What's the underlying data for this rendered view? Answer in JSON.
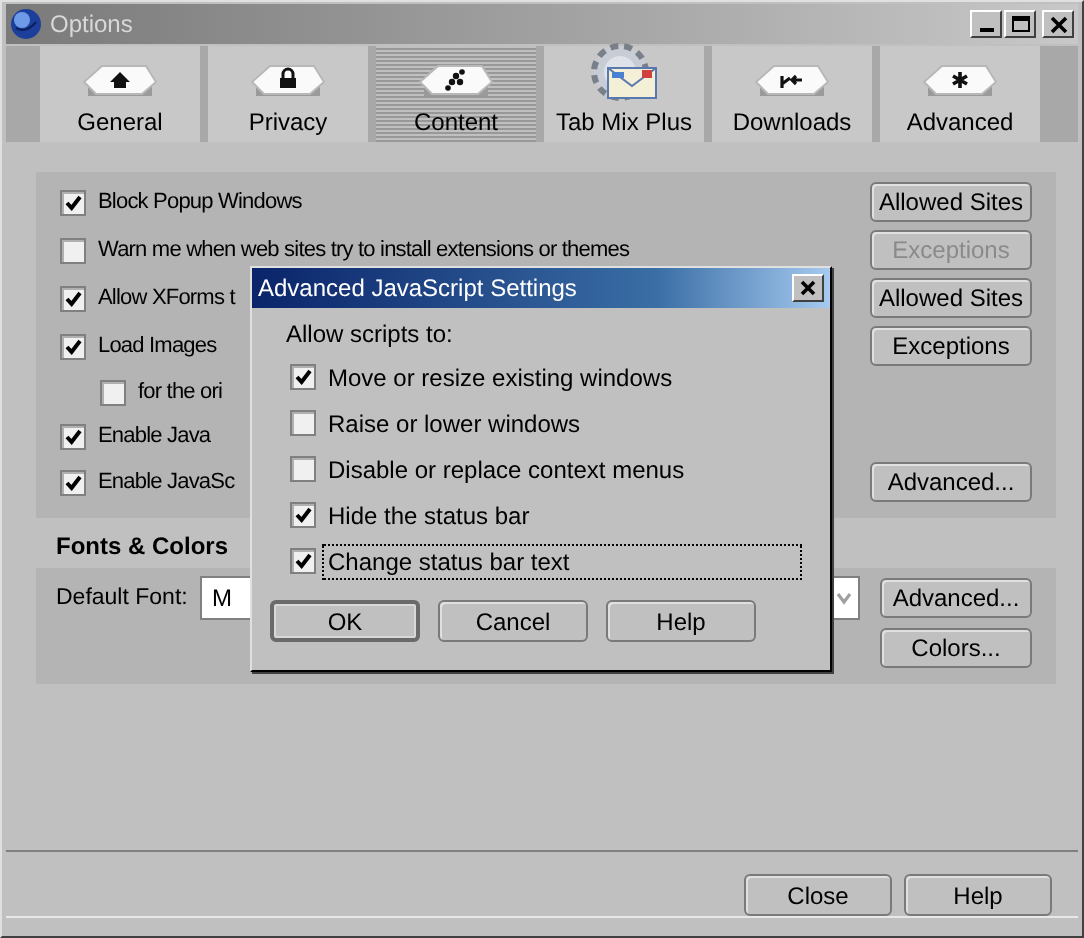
{
  "window": {
    "title": "Options"
  },
  "tabs": [
    {
      "label": "General",
      "selected": false
    },
    {
      "label": "Privacy",
      "selected": false
    },
    {
      "label": "Content",
      "selected": true
    },
    {
      "label": "Tab Mix Plus",
      "selected": false
    },
    {
      "label": "Downloads",
      "selected": false
    },
    {
      "label": "Advanced",
      "selected": false
    }
  ],
  "content_options": [
    {
      "label": "Block Popup Windows",
      "checked": true,
      "button": {
        "label": "Allowed Sites",
        "disabled": false
      }
    },
    {
      "label": "Warn me when web sites try to install extensions or themes",
      "checked": false,
      "button": {
        "label": "Exceptions",
        "disabled": true
      }
    },
    {
      "label": "Allow XForms t",
      "checked": true,
      "button": {
        "label": "Allowed Sites",
        "disabled": false
      }
    },
    {
      "label": "Load Images",
      "checked": true,
      "button": {
        "label": "Exceptions",
        "disabled": false
      },
      "children": [
        {
          "label": "for the ori",
          "checked": false
        }
      ]
    },
    {
      "label": "Enable Java",
      "checked": true
    },
    {
      "label": "Enable JavaSc",
      "checked": true,
      "button": {
        "label": "Advanced...",
        "disabled": false
      }
    }
  ],
  "fonts_colors": {
    "heading": "Fonts & Colors",
    "default_font_label": "Default Font:",
    "default_font_value": "M",
    "buttons": [
      "Advanced...",
      "Colors..."
    ]
  },
  "dialog": {
    "title": "Advanced JavaScript Settings",
    "prompt": "Allow scripts to:",
    "options": [
      {
        "label": "Move or resize existing windows",
        "checked": true,
        "focused": false
      },
      {
        "label": "Raise or lower windows",
        "checked": false,
        "focused": false
      },
      {
        "label": "Disable or replace context menus",
        "checked": false,
        "focused": false
      },
      {
        "label": "Hide the status bar",
        "checked": true,
        "focused": false
      },
      {
        "label": "Change status bar text",
        "checked": true,
        "focused": true
      }
    ],
    "buttons": [
      {
        "label": "OK",
        "default": true
      },
      {
        "label": "Cancel",
        "default": false
      },
      {
        "label": "Help",
        "default": false
      }
    ]
  },
  "footer_buttons": [
    "Close",
    "Help"
  ]
}
